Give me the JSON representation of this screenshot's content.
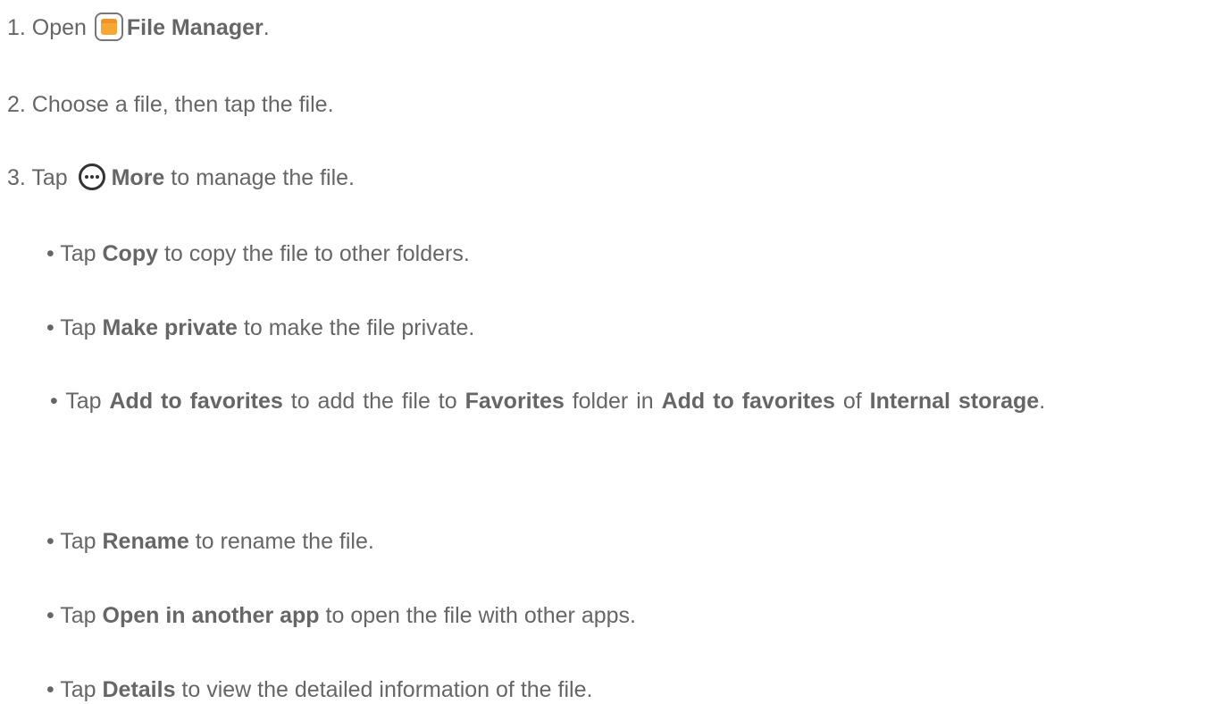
{
  "steps": [
    {
      "num": "1. Open",
      "bold": "File Manager",
      "end": ".",
      "icon": "file-manager-folder-icon"
    },
    {
      "text": "2. Choose a file, then tap the file."
    },
    {
      "num": "3. Tap",
      "bold": "More",
      "end": " to manage the file.",
      "icon": "more-ellipsis-icon"
    }
  ],
  "bullets": [
    {
      "pre": "• Tap ",
      "bold": "Copy",
      "post": " to copy the file to other folders."
    },
    {
      "pre": "• Tap ",
      "bold": "Make private",
      "post": " to make the file private."
    },
    {
      "pre": "• Tap ",
      "bold": "Add to favorites",
      "post": " to add the file to ",
      "bold2": "Favorites",
      "post2": " folder in ",
      "bold3": "Add to favorites",
      "post3": " of ",
      "bold4": "Internal storage",
      "post4": "."
    },
    {
      "pre": "• Tap ",
      "bold": "Rename",
      "post": " to rename the file."
    },
    {
      "pre": "• Tap ",
      "bold": "Open in another app",
      "post": " to open the file with other apps."
    },
    {
      "pre": "• Tap ",
      "bold": "Details",
      "post": " to view the detailed information of the file."
    }
  ],
  "colors": {
    "text": "#666666",
    "folder_fill": "#f7a733",
    "icon_outline": "#777777"
  }
}
